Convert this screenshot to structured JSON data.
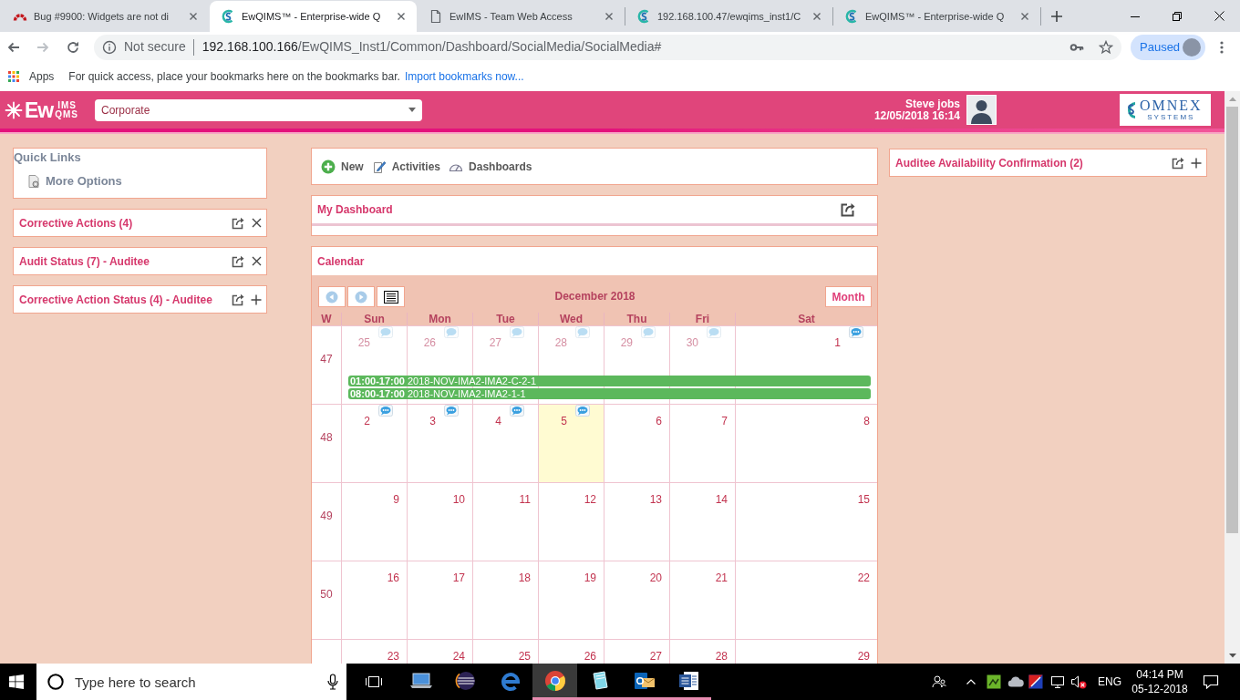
{
  "browser": {
    "tabs": [
      {
        "kind": "arc",
        "title": "Bug #9900: Widgets are not di",
        "selected": false
      },
      {
        "kind": "logo",
        "title": "EwQIMS™ - Enterprise-wide Q",
        "selected": true
      },
      {
        "kind": "page",
        "title": "EwIMS - Team Web Access",
        "selected": false
      },
      {
        "kind": "logo",
        "title": "192.168.100.47/ewqims_inst1/C",
        "selected": false
      },
      {
        "kind": "logo",
        "title": "EwQIMS™ - Enterprise-wide Q",
        "selected": false
      }
    ],
    "address_bar": {
      "security": "Not secure",
      "host": "192.168.100.166",
      "path": "/EwQIMS_Inst1/Common/Dashboard/SocialMedia/SocialMedia#"
    },
    "profile": {
      "status": "Paused"
    },
    "bookmarks_bar": {
      "apps": "Apps",
      "hint": "For quick access, place your bookmarks here on the bookmarks bar.",
      "link": "Import bookmarks now..."
    }
  },
  "app_header": {
    "logo": {
      "main": "Ew",
      "upper": "IMS",
      "lower": "QMS"
    },
    "site_select": {
      "value": "Corporate"
    },
    "user": {
      "name": "Steve jobs",
      "datetime": "12/05/2018 16:14"
    },
    "company_logo": {
      "name": "OMNEX",
      "tagline": "SYSTEMS"
    }
  },
  "quick_links": {
    "title": "Quick Links",
    "items": [
      "More Options"
    ]
  },
  "left_widgets": [
    {
      "title": "Corrective Actions (4)",
      "kind": "closable"
    },
    {
      "title": "Audit Status (7) - Auditee",
      "kind": "closable"
    },
    {
      "title": "Corrective Action Status (4) - Auditee",
      "kind": "addable"
    }
  ],
  "toolbar": [
    {
      "kind": "new",
      "label": "New"
    },
    {
      "kind": "edit",
      "label": "Activities"
    },
    {
      "kind": "gauge",
      "label": "Dashboards"
    }
  ],
  "my_dashboard": {
    "title": "My Dashboard"
  },
  "calendar": {
    "title": "Calendar",
    "period": "December 2018",
    "view_button": "Month",
    "week_header": "W",
    "weekdays": [
      "Sun",
      "Mon",
      "Tue",
      "Wed",
      "Thu",
      "Fri",
      "Sat"
    ],
    "weeks": [
      {
        "number": "47",
        "days": [
          {
            "date": "25",
            "other_month": true,
            "today": false,
            "comments": true
          },
          {
            "date": "26",
            "other_month": true,
            "today": false,
            "comments": true
          },
          {
            "date": "27",
            "other_month": true,
            "today": false,
            "comments": true
          },
          {
            "date": "28",
            "other_month": true,
            "today": false,
            "comments": true
          },
          {
            "date": "29",
            "other_month": true,
            "today": false,
            "comments": true
          },
          {
            "date": "30",
            "other_month": true,
            "today": false,
            "comments": true
          },
          {
            "date": "1",
            "other_month": false,
            "today": false,
            "comments": true
          }
        ],
        "events": [
          {
            "time": "01:00-17:00",
            "title": "2018-NOV-IMA2-IMA2-C-2-1"
          },
          {
            "time": "08:00-17:00",
            "title": "2018-NOV-IMA2-IMA2-1-1"
          }
        ]
      },
      {
        "number": "48",
        "days": [
          {
            "date": "2",
            "other_month": false,
            "today": false,
            "comments": true
          },
          {
            "date": "3",
            "other_month": false,
            "today": false,
            "comments": true
          },
          {
            "date": "4",
            "other_month": false,
            "today": false,
            "comments": true
          },
          {
            "date": "5",
            "other_month": false,
            "today": true,
            "comments": true
          },
          {
            "date": "6",
            "other_month": false,
            "today": false,
            "comments": false
          },
          {
            "date": "7",
            "other_month": false,
            "today": false,
            "comments": false
          },
          {
            "date": "8",
            "other_month": false,
            "today": false,
            "comments": false
          }
        ]
      },
      {
        "number": "49",
        "days": [
          {
            "date": "9",
            "other_month": false,
            "today": false,
            "comments": false
          },
          {
            "date": "10",
            "other_month": false,
            "today": false,
            "comments": false
          },
          {
            "date": "11",
            "other_month": false,
            "today": false,
            "comments": false
          },
          {
            "date": "12",
            "other_month": false,
            "today": false,
            "comments": false
          },
          {
            "date": "13",
            "other_month": false,
            "today": false,
            "comments": false
          },
          {
            "date": "14",
            "other_month": false,
            "today": false,
            "comments": false
          },
          {
            "date": "15",
            "other_month": false,
            "today": false,
            "comments": false
          }
        ]
      },
      {
        "number": "50",
        "days": [
          {
            "date": "16",
            "other_month": false,
            "today": false,
            "comments": false
          },
          {
            "date": "17",
            "other_month": false,
            "today": false,
            "comments": false
          },
          {
            "date": "18",
            "other_month": false,
            "today": false,
            "comments": false
          },
          {
            "date": "19",
            "other_month": false,
            "today": false,
            "comments": false
          },
          {
            "date": "20",
            "other_month": false,
            "today": false,
            "comments": false
          },
          {
            "date": "21",
            "other_month": false,
            "today": false,
            "comments": false
          },
          {
            "date": "22",
            "other_month": false,
            "today": false,
            "comments": false
          }
        ]
      },
      {
        "days": [
          {
            "date": "23",
            "other_month": false,
            "today": false,
            "comments": false
          },
          {
            "date": "24",
            "other_month": false,
            "today": false,
            "comments": false
          },
          {
            "date": "25",
            "other_month": false,
            "today": false,
            "comments": false
          },
          {
            "date": "26",
            "other_month": false,
            "today": false,
            "comments": false
          },
          {
            "date": "27",
            "other_month": false,
            "today": false,
            "comments": false
          },
          {
            "date": "28",
            "other_month": false,
            "today": false,
            "comments": false
          },
          {
            "date": "29",
            "other_month": false,
            "today": false,
            "comments": false
          }
        ]
      }
    ]
  },
  "right_widgets": [
    {
      "title": "Auditee Availability Confirmation (2)",
      "kind": "addable"
    }
  ],
  "taskbar": {
    "search": {
      "placeholder": "Type here to search"
    },
    "apps": [
      {
        "kind": "laptop",
        "running": false,
        "active": false
      },
      {
        "kind": "sphere",
        "running": false,
        "active": false
      },
      {
        "kind": "swoosh",
        "running": false,
        "active": false
      },
      {
        "kind": "tricolor",
        "running": true,
        "active": true
      },
      {
        "kind": "page",
        "running": true,
        "active": false
      },
      {
        "kind": "mail",
        "running": true,
        "active": false
      },
      {
        "kind": "doc",
        "running": true,
        "active": false
      }
    ],
    "language": "ENG",
    "time": "04:14 PM",
    "date": "05-12-2018"
  }
}
